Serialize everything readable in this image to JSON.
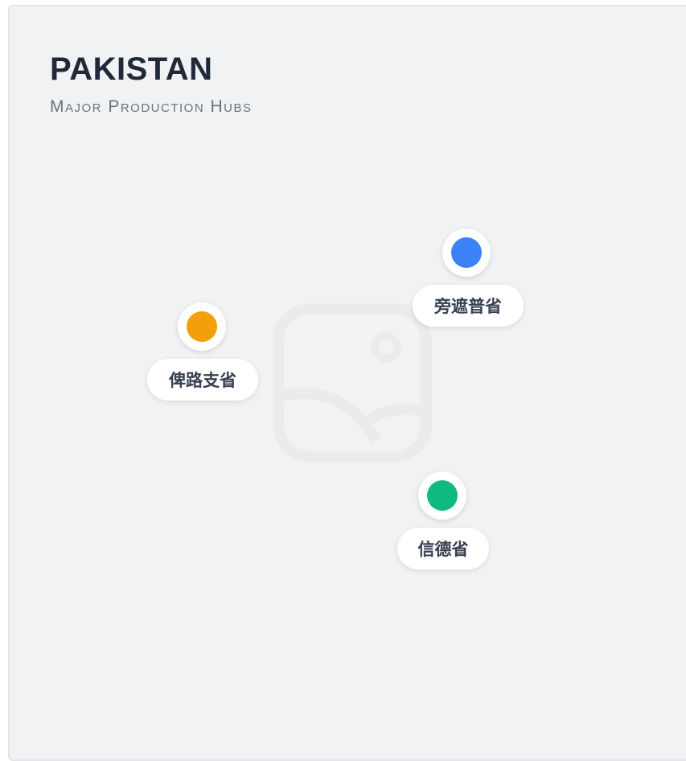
{
  "map": {
    "title": "PAKISTAN",
    "subtitle": "Major Production Hubs",
    "markers": [
      {
        "name": "旁遮普省",
        "color": "#3b82f6"
      },
      {
        "name": "俾路支省",
        "color": "#f59e0b"
      },
      {
        "name": "信德省",
        "color": "#10b981"
      }
    ]
  }
}
